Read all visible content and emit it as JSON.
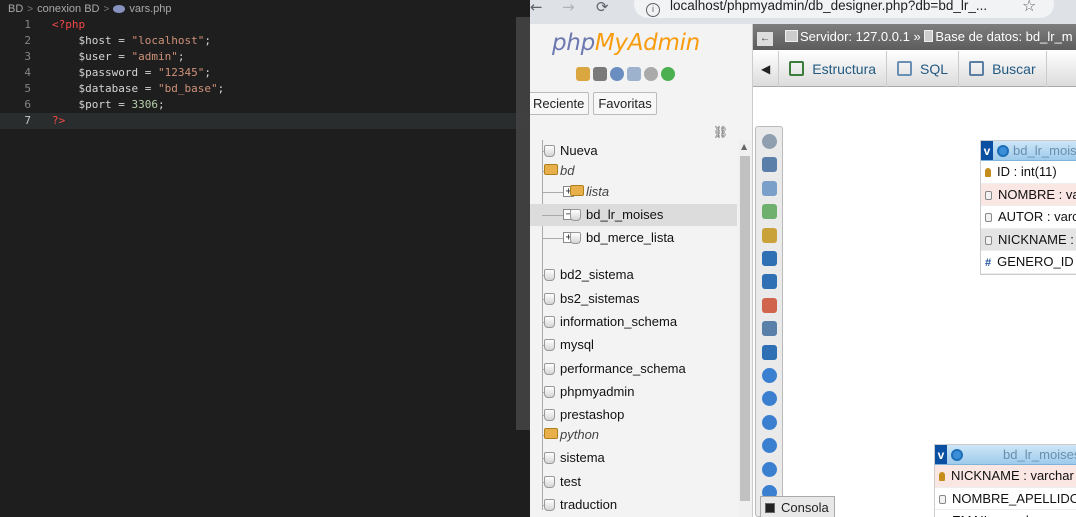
{
  "editor": {
    "breadcrumb": [
      "BD",
      "conexion BD",
      "vars.php"
    ],
    "lines": [
      {
        "n": "1",
        "segments": [
          {
            "cls": "tag",
            "text": "<?php"
          }
        ]
      },
      {
        "n": "2",
        "segments": [
          {
            "cls": "var",
            "text": "    $host"
          },
          {
            "cls": "op",
            "text": " = "
          },
          {
            "cls": "str",
            "text": "\"localhost\""
          },
          {
            "cls": "op",
            "text": ";"
          }
        ]
      },
      {
        "n": "3",
        "segments": [
          {
            "cls": "var",
            "text": "    $user"
          },
          {
            "cls": "op",
            "text": " = "
          },
          {
            "cls": "str",
            "text": "\"admin\""
          },
          {
            "cls": "op",
            "text": ";"
          }
        ]
      },
      {
        "n": "4",
        "segments": [
          {
            "cls": "var",
            "text": "    $password"
          },
          {
            "cls": "op",
            "text": " = "
          },
          {
            "cls": "str",
            "text": "\"12345\""
          },
          {
            "cls": "op",
            "text": ";"
          }
        ]
      },
      {
        "n": "5",
        "segments": [
          {
            "cls": "var",
            "text": "    $database"
          },
          {
            "cls": "op",
            "text": " = "
          },
          {
            "cls": "str",
            "text": "\"bd_base\""
          },
          {
            "cls": "op",
            "text": ";"
          }
        ]
      },
      {
        "n": "6",
        "segments": [
          {
            "cls": "var",
            "text": "    $port"
          },
          {
            "cls": "op",
            "text": " = "
          },
          {
            "cls": "num",
            "text": "3306"
          },
          {
            "cls": "op",
            "text": ";"
          }
        ]
      },
      {
        "n": "7",
        "segments": [
          {
            "cls": "tag",
            "text": "?>"
          }
        ],
        "active": true
      }
    ]
  },
  "browser": {
    "url": "localhost/phpmyadmin/db_designer.php?db=bd_lr_...",
    "back_glyph": "←",
    "forward_glyph": "→",
    "reload_glyph": "⟳",
    "star_glyph": "☆"
  },
  "pma": {
    "logo_php": "php",
    "logo_myadmin": "MyAdmin",
    "nav_tabs": [
      "Reciente",
      "Favoritas"
    ],
    "tree": [
      {
        "label": "Nueva",
        "icon": "db",
        "level": 0,
        "expander": ""
      },
      {
        "label": "bd",
        "icon": "folder",
        "level": 0,
        "expander": "",
        "group": true
      },
      {
        "label": "lista",
        "icon": "folder",
        "level": 1,
        "expander": "+",
        "group": true
      },
      {
        "label": "bd_lr_moises",
        "icon": "db",
        "level": 1,
        "expander": "−",
        "selected": true
      },
      {
        "label": "bd_merce_lista",
        "icon": "db",
        "level": 1,
        "expander": "+"
      },
      {
        "label": "bd2_sistema",
        "icon": "db",
        "level": 0,
        "expander": ""
      },
      {
        "label": "bs2_sistemas",
        "icon": "db",
        "level": 0,
        "expander": ""
      },
      {
        "label": "information_schema",
        "icon": "db",
        "level": 0,
        "expander": ""
      },
      {
        "label": "mysql",
        "icon": "db",
        "level": 0,
        "expander": ""
      },
      {
        "label": "performance_schema",
        "icon": "db",
        "level": 0,
        "expander": ""
      },
      {
        "label": "phpmyadmin",
        "icon": "db",
        "level": 0,
        "expander": ""
      },
      {
        "label": "prestashop",
        "icon": "db",
        "level": 0,
        "expander": ""
      },
      {
        "label": "python",
        "icon": "folder",
        "level": 0,
        "expander": "",
        "group": true
      },
      {
        "label": "sistema",
        "icon": "db",
        "level": 0,
        "expander": ""
      },
      {
        "label": "test",
        "icon": "db",
        "level": 0,
        "expander": ""
      },
      {
        "label": "traduction",
        "icon": "db",
        "level": 0,
        "expander": ""
      }
    ],
    "server_bar": {
      "server": "Servidor: 127.0.0.1 »",
      "database": "Base de datos: bd_lr_m"
    },
    "top_tabs": [
      {
        "label": "Estructura",
        "icon": "structure-icon",
        "color": "#3c7c3c"
      },
      {
        "label": "SQL",
        "icon": "sql-icon",
        "color": "#6a8fb5"
      },
      {
        "label": "Buscar",
        "icon": "search-icon",
        "color": "#5b7ea3"
      }
    ],
    "designer_tools": [
      {
        "icon": "angular-links-icon",
        "color": "#8f9fb0",
        "round": true
      },
      {
        "icon": "fullscreen-icon",
        "color": "#5a7fa8",
        "round": false
      },
      {
        "icon": "add-tables-icon",
        "color": "#7a9fc8",
        "round": false
      },
      {
        "icon": "new-page-icon",
        "color": "#6fb06f",
        "round": false
      },
      {
        "icon": "edit-page-icon",
        "color": "#c9a23a",
        "round": false
      },
      {
        "icon": "save-icon",
        "color": "#2f6fb3",
        "round": false
      },
      {
        "icon": "save-as-icon",
        "color": "#2f6fb3",
        "round": false
      },
      {
        "icon": "delete-page-icon",
        "color": "#d0644c",
        "round": false
      },
      {
        "icon": "create-table-icon",
        "color": "#5a7fa8",
        "round": false
      },
      {
        "icon": "create-relation-icon",
        "color": "#2f6fb3",
        "round": false
      },
      {
        "icon": "choose-column-icon",
        "color": "#3a7fd0",
        "round": true
      },
      {
        "icon": "reload-icon",
        "color": "#3a7fd0",
        "round": true
      },
      {
        "icon": "help-icon",
        "color": "#3a7fd0",
        "round": true
      },
      {
        "icon": "angular-direct-links-icon",
        "color": "#3a7fd0",
        "round": true
      },
      {
        "icon": "snap-to-grid-icon",
        "color": "#3a7fd0",
        "round": true
      },
      {
        "icon": "small-big-icon",
        "color": "#3a7fd0",
        "round": true
      }
    ],
    "tables": [
      {
        "name": "bd_lr_moises",
        "rows": [
          {
            "text": "ID : int(11)",
            "icon": "key",
            "style": ""
          },
          {
            "text": "NOMBRE : varchar",
            "icon": "col",
            "style": "alt"
          },
          {
            "text": "AUTOR : varchar",
            "icon": "col",
            "style": ""
          },
          {
            "text": "NICKNAME : varchar",
            "icon": "col",
            "style": "gray"
          },
          {
            "text": "GENERO_ID",
            "icon": "hash",
            "style": ""
          }
        ]
      },
      {
        "name": "bd_lr_moises",
        "rows": [
          {
            "text": "NICKNAME : varchar",
            "icon": "key",
            "style": "alt"
          },
          {
            "text": "NOMBRE_APELLIDO",
            "icon": "col",
            "style": ""
          },
          {
            "text": "EMAIL : varchar",
            "icon": "col",
            "style": ""
          }
        ]
      }
    ],
    "console_label": "Consola"
  }
}
